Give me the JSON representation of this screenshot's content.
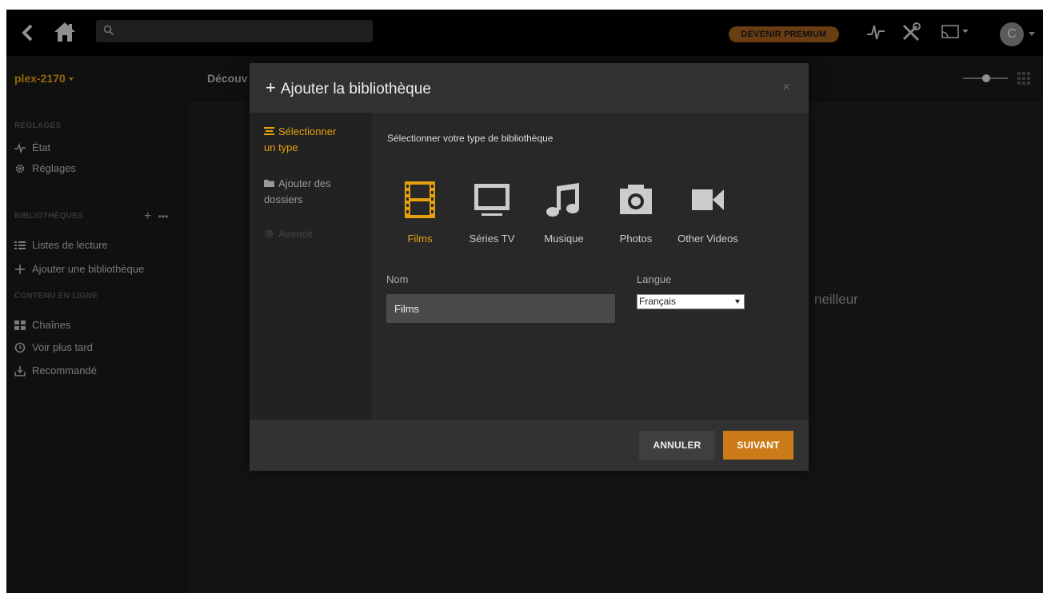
{
  "topbar": {
    "search_placeholder": "",
    "premium_label": "DEVENIR PREMIUM",
    "avatar_initial": "C"
  },
  "subbar": {
    "server": "plex-2170",
    "discover": "Découv"
  },
  "sidebar": {
    "section_settings": "RÉGLAGES",
    "item_status": "État",
    "item_settings": "Réglages",
    "section_libraries": "BIBLIOTHÈQUES",
    "item_playlists": "Listes de lecture",
    "item_add_library": "Ajouter une bibliothèque",
    "section_online": "CONTENU EN LIGNE",
    "item_channels": "Chaînes",
    "item_watch_later": "Voir plus tard",
    "item_recommended": "Recommandé"
  },
  "background": {
    "partial_text": "neilleur"
  },
  "modal": {
    "title": "Ajouter la bibliothèque",
    "close": "×",
    "steps": {
      "select_type_1": "Sélectionner",
      "select_type_2": "un type",
      "add_folders_1": "Ajouter des",
      "add_folders_2": "dossiers",
      "advanced": "Avancé"
    },
    "subtitle": "Sélectionner votre type de bibliothèque",
    "types": {
      "movies": "Films",
      "tv": "Séries TV",
      "music": "Musique",
      "photos": "Photos",
      "other": "Other Videos"
    },
    "name_label": "Nom",
    "name_value": "Films",
    "language_label": "Langue",
    "language_value": "Français",
    "cancel_label": "ANNULER",
    "next_label": "SUIVANT"
  },
  "colors": {
    "accent": "#e5a00d",
    "next_button": "#cc7b19",
    "premium": "#a35f1e"
  }
}
